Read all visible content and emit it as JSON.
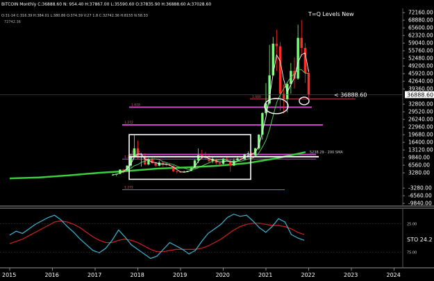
{
  "header": {
    "symbol_line": "BITCOIN Monthly C:36888.60 N: 954.40 H:37867.00 L:35590.60 O:37835.90 H:36888.60 A:37028.60",
    "indicator_line": "O:31-14 C:316.39 H:384.01 L:380.86 O:374.39 V:27 1.8 C:32742.36 H:8155 N:58.33",
    "small_value": "72742.36"
  },
  "title": "T=Q Levels New",
  "colors": {
    "background": "#000000",
    "up_candle": "#7dff7d",
    "down_candle": "#ff2a2a",
    "fib_line": "#cc44cc",
    "sma": "#3ccf3c",
    "box": "#ffffff",
    "stoch_k": "#3cb8d8",
    "stoch_d": "#d42020"
  },
  "price_axis": {
    "ticks": [
      "72160.00",
      "68880.00",
      "65600.00",
      "62320.00",
      "59040.00",
      "55760.00",
      "52480.00",
      "49200.00",
      "45920.00",
      "42640.00",
      "39360.00",
      "32800.00",
      "29520.00",
      "26240.00",
      "22960.00",
      "19680.00",
      "16400.00",
      "13120.00",
      "9840.00",
      "6560.00",
      "3280.00",
      "-3280.00",
      "-6560.00",
      "-9840.00"
    ],
    "last_price": "36888.60",
    "last_price_label": "< 36888.60"
  },
  "annotations": {
    "sma_label": "5238.29 - 200 SMA",
    "fib_small": [
      "1.000",
      "1.618",
      "1.272",
      "1.618",
      "1.272",
      "1.272"
    ]
  },
  "stoch": {
    "label": "STO 24.2",
    "levels": [
      "25.00",
      "75.00"
    ]
  },
  "chart_data": {
    "type": "candlestick",
    "title": "T=Q Levels New",
    "x_labels": [
      "2015",
      "2016",
      "2017",
      "2018",
      "2019",
      "2020",
      "2021",
      "2022",
      "2023",
      "2024"
    ],
    "ylim": [
      -11000,
      74000
    ],
    "candles": [
      {
        "t": "2017-06",
        "o": 2400,
        "h": 2900,
        "l": 2100,
        "c": 2500
      },
      {
        "t": "2017-07",
        "o": 2500,
        "h": 2900,
        "l": 1900,
        "c": 2850
      },
      {
        "t": "2017-08",
        "o": 2850,
        "h": 4700,
        "l": 2700,
        "c": 4700
      },
      {
        "t": "2017-09",
        "o": 4700,
        "h": 5000,
        "l": 3000,
        "c": 4300
      },
      {
        "t": "2017-10",
        "o": 4300,
        "h": 6500,
        "l": 4200,
        "c": 6400
      },
      {
        "t": "2017-11",
        "o": 6400,
        "h": 11400,
        "l": 5500,
        "c": 10000
      },
      {
        "t": "2017-12",
        "o": 10000,
        "h": 19700,
        "l": 10000,
        "c": 13800
      },
      {
        "t": "2018-01",
        "o": 13800,
        "h": 17200,
        "l": 9300,
        "c": 10200
      },
      {
        "t": "2018-02",
        "o": 10200,
        "h": 11800,
        "l": 6000,
        "c": 10300
      },
      {
        "t": "2018-03",
        "o": 10300,
        "h": 11700,
        "l": 6600,
        "c": 6900
      },
      {
        "t": "2018-04",
        "o": 6900,
        "h": 9700,
        "l": 6500,
        "c": 9200
      },
      {
        "t": "2018-05",
        "o": 9200,
        "h": 10000,
        "l": 7100,
        "c": 7500
      },
      {
        "t": "2018-06",
        "o": 7500,
        "h": 7800,
        "l": 5800,
        "c": 6400
      },
      {
        "t": "2018-07",
        "o": 6400,
        "h": 8500,
        "l": 6100,
        "c": 7700
      },
      {
        "t": "2018-08",
        "o": 7700,
        "h": 7800,
        "l": 5900,
        "c": 7000
      },
      {
        "t": "2018-09",
        "o": 7000,
        "h": 7400,
        "l": 6100,
        "c": 6600
      },
      {
        "t": "2018-10",
        "o": 6600,
        "h": 7100,
        "l": 6100,
        "c": 6300
      },
      {
        "t": "2018-11",
        "o": 6300,
        "h": 6600,
        "l": 3600,
        "c": 4000
      },
      {
        "t": "2018-12",
        "o": 4000,
        "h": 4200,
        "l": 3100,
        "c": 3700
      },
      {
        "t": "2019-01",
        "o": 3700,
        "h": 4100,
        "l": 3400,
        "c": 3400
      },
      {
        "t": "2019-02",
        "o": 3400,
        "h": 4200,
        "l": 3400,
        "c": 3800
      },
      {
        "t": "2019-03",
        "o": 3800,
        "h": 4100,
        "l": 3700,
        "c": 4100
      },
      {
        "t": "2019-04",
        "o": 4100,
        "h": 5600,
        "l": 4100,
        "c": 5300
      },
      {
        "t": "2019-05",
        "o": 5300,
        "h": 9000,
        "l": 5300,
        "c": 8600
      },
      {
        "t": "2019-06",
        "o": 8600,
        "h": 13800,
        "l": 7500,
        "c": 10800
      },
      {
        "t": "2019-07",
        "o": 10800,
        "h": 13200,
        "l": 9100,
        "c": 10100
      },
      {
        "t": "2019-08",
        "o": 10100,
        "h": 12300,
        "l": 9400,
        "c": 9600
      },
      {
        "t": "2019-09",
        "o": 9600,
        "h": 10900,
        "l": 7700,
        "c": 8300
      },
      {
        "t": "2019-10",
        "o": 8300,
        "h": 10400,
        "l": 7400,
        "c": 9200
      },
      {
        "t": "2019-11",
        "o": 9200,
        "h": 9500,
        "l": 6500,
        "c": 7600
      },
      {
        "t": "2019-12",
        "o": 7600,
        "h": 7700,
        "l": 6400,
        "c": 7200
      },
      {
        "t": "2020-01",
        "o": 7200,
        "h": 9600,
        "l": 6900,
        "c": 9400
      },
      {
        "t": "2020-02",
        "o": 9400,
        "h": 10500,
        "l": 8400,
        "c": 8500
      },
      {
        "t": "2020-03",
        "o": 8500,
        "h": 9200,
        "l": 3800,
        "c": 6400
      },
      {
        "t": "2020-04",
        "o": 6400,
        "h": 9500,
        "l": 6200,
        "c": 8600
      },
      {
        "t": "2020-05",
        "o": 8600,
        "h": 10100,
        "l": 8100,
        "c": 9500
      },
      {
        "t": "2020-06",
        "o": 9500,
        "h": 10400,
        "l": 8900,
        "c": 9100
      },
      {
        "t": "2020-07",
        "o": 9100,
        "h": 11400,
        "l": 8900,
        "c": 11300
      },
      {
        "t": "2020-08",
        "o": 11300,
        "h": 12500,
        "l": 11000,
        "c": 11700
      },
      {
        "t": "2020-09",
        "o": 11700,
        "h": 12100,
        "l": 9800,
        "c": 10800
      },
      {
        "t": "2020-10",
        "o": 10800,
        "h": 14100,
        "l": 10400,
        "c": 13800
      },
      {
        "t": "2020-11",
        "o": 13800,
        "h": 19900,
        "l": 13200,
        "c": 19700
      },
      {
        "t": "2020-12",
        "o": 19700,
        "h": 29300,
        "l": 17600,
        "c": 29000
      },
      {
        "t": "2021-01",
        "o": 29000,
        "h": 41900,
        "l": 28200,
        "c": 33100
      },
      {
        "t": "2021-02",
        "o": 33100,
        "h": 58300,
        "l": 32400,
        "c": 45200
      },
      {
        "t": "2021-03",
        "o": 45200,
        "h": 61700,
        "l": 45000,
        "c": 58800
      },
      {
        "t": "2021-04",
        "o": 58800,
        "h": 64800,
        "l": 47000,
        "c": 57700
      },
      {
        "t": "2021-05",
        "o": 57700,
        "h": 59500,
        "l": 30000,
        "c": 37300
      },
      {
        "t": "2021-06",
        "o": 37300,
        "h": 41300,
        "l": 28800,
        "c": 35000
      },
      {
        "t": "2021-07",
        "o": 35000,
        "h": 42300,
        "l": 29300,
        "c": 41500
      },
      {
        "t": "2021-08",
        "o": 41500,
        "h": 50500,
        "l": 37300,
        "c": 47100
      },
      {
        "t": "2021-09",
        "o": 47100,
        "h": 52900,
        "l": 39600,
        "c": 43800
      },
      {
        "t": "2021-10",
        "o": 43800,
        "h": 67000,
        "l": 43300,
        "c": 61300
      },
      {
        "t": "2021-11",
        "o": 61300,
        "h": 69000,
        "l": 53300,
        "c": 57000
      },
      {
        "t": "2021-12",
        "o": 57000,
        "h": 59100,
        "l": 42000,
        "c": 46200
      },
      {
        "t": "2022-01",
        "o": 46200,
        "h": 47900,
        "l": 35500,
        "c": 36888
      }
    ],
    "fib_levels": [
      {
        "label": "1.000",
        "value": 35000
      },
      {
        "label": "1.618",
        "value": 31500
      },
      {
        "label": "1.272",
        "value": 23900
      },
      {
        "label": "1.618",
        "value": 11200
      },
      {
        "label": "1.272",
        "value": 9200
      },
      {
        "label": "1.272",
        "value": -4000
      }
    ],
    "sma_200": {
      "label": "5238.29 - 200 SMA",
      "values": [
        900,
        1300,
        2200,
        3300,
        4100,
        5100,
        5600,
        6300,
        7400,
        9500,
        12200
      ]
    },
    "stochastic": {
      "k": [
        55,
        62,
        58,
        66,
        74,
        80,
        86,
        90,
        82,
        70,
        60,
        48,
        38,
        28,
        24,
        32,
        46,
        64,
        52,
        38,
        30,
        22,
        14,
        18,
        30,
        42,
        36,
        30,
        22,
        28,
        44,
        58,
        66,
        74,
        86,
        92,
        88,
        90,
        80,
        68,
        60,
        70,
        84,
        78,
        56,
        50,
        46
      ],
      "d": [
        40,
        44,
        48,
        54,
        60,
        66,
        72,
        78,
        80,
        78,
        74,
        68,
        60,
        52,
        46,
        42,
        42,
        46,
        48,
        46,
        42,
        36,
        30,
        26,
        26,
        28,
        30,
        30,
        30,
        30,
        32,
        36,
        42,
        48,
        56,
        64,
        70,
        74,
        76,
        76,
        74,
        72,
        72,
        70,
        66,
        60,
        56
      ]
    }
  }
}
